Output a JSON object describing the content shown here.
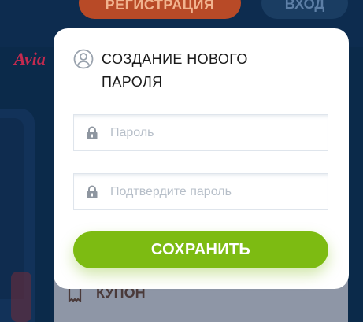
{
  "background": {
    "register_label": "РЕГИСТРАЦИЯ",
    "login_label": "ВХОД",
    "logo_text": "Avia",
    "coupon_label": "КУПОН"
  },
  "modal": {
    "title": "СОЗДАНИЕ НОВОГО ПАРОЛЯ",
    "title_icon": "user-circle-icon",
    "password_placeholder": "Пароль",
    "confirm_placeholder": "Подтвердите пароль",
    "field_icon": "lock-icon",
    "save_label": "СОХРАНИТЬ"
  },
  "colors": {
    "save_button": "#7dbb12",
    "register_button": "#b84a27",
    "page_background": "#0b2a4a"
  }
}
